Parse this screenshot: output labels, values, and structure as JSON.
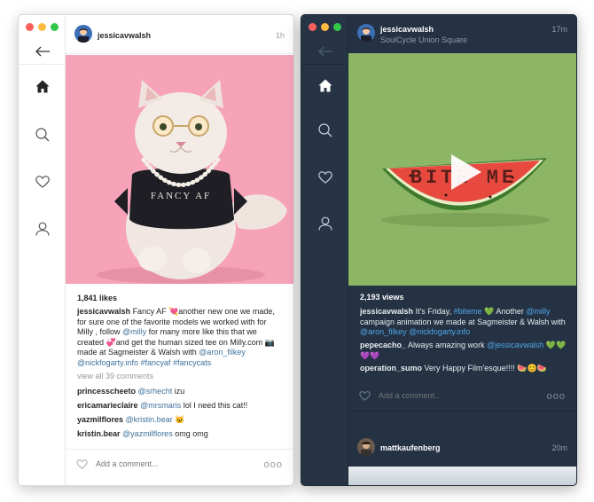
{
  "light_window": {
    "post": {
      "username": "jessicavwalsh",
      "time": "1h",
      "likes": "1,841 likes",
      "caption": {
        "user": "jessicavwalsh",
        "t1": "Fancy AF 💘another new one we made, for sure one of the favorite models we worked with for Milly , follow ",
        "m1": "@milly",
        "t2": " for many more like this that we created 💞and get the human sized tee on Milly.com 📷 made at Sagmeister & Walsh with ",
        "m2": "@aron_filkey",
        "m3": "@nickfogarty.info",
        "h1": "#fancyaf",
        "h2": "#fancycats"
      },
      "view_all": "view all 39 comments",
      "comments": [
        {
          "user": "princesscheeto",
          "mention": "@srhecht",
          "text": " izu"
        },
        {
          "user": "ericamarieclaire",
          "mention": "@mrsmaris",
          "text": " lol I need this cat!!"
        },
        {
          "user": "yazmilflores",
          "mention": "@kristin.bear",
          "text": " 🐱"
        },
        {
          "user": "kristin.bear",
          "mention": "@yazmilflores",
          "text": " omg omg"
        }
      ],
      "add_comment_placeholder": "Add a comment...",
      "more": "ooo",
      "shirt_text": "FANCY AF"
    }
  },
  "dark_window": {
    "post": {
      "username": "jessicavwalsh",
      "location": "SoulCycle Union Square",
      "time": "17m",
      "views": "2,193 views",
      "caption": {
        "user": "jessicavwalsh",
        "t1": "It's Friday, ",
        "h1": "#biteme",
        "t2": " 💚 Another ",
        "m1": "@milly",
        "t3": " campaign animation we made at Sagmeister & Walsh with ",
        "m2": "@aron_filkey",
        "m3": "@nickfogarty.info"
      },
      "comments": [
        {
          "user": "pepecacho_",
          "text": " Always amazing work ",
          "mention": "@jessicavwalsh",
          "emoji": " 💚💚💜💜"
        },
        {
          "user": "operation_sumo",
          "text": " Very Happy Film'esque!!!! 🍉😊🍉"
        }
      ],
      "add_comment_placeholder": "Add a comment...",
      "more": "ooo",
      "melon_text": "BITE ME"
    },
    "next_post": {
      "username": "mattkaufenberg",
      "time": "20m"
    }
  }
}
